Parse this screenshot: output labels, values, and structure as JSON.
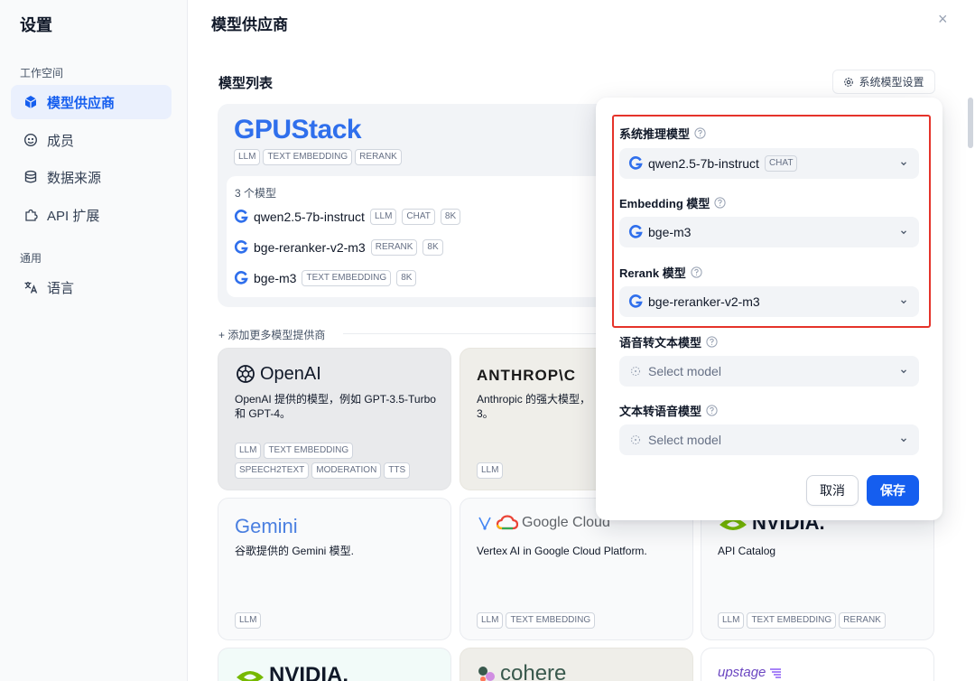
{
  "sidebar": {
    "title": "设置",
    "group_workspace": "工作空间",
    "group_general": "通用",
    "items": [
      {
        "label": "模型供应商"
      },
      {
        "label": "成员"
      },
      {
        "label": "数据来源"
      },
      {
        "label": "API 扩展"
      },
      {
        "label": "语言"
      }
    ]
  },
  "header": {
    "title": "模型供应商",
    "close": "×"
  },
  "model_list": {
    "title": "模型列表",
    "system_settings_button": "系统模型设置"
  },
  "gpustack": {
    "logo": "GPUStack",
    "tags": [
      "LLM",
      "TEXT EMBEDDING",
      "RERANK"
    ],
    "count": "3 个模型",
    "models": [
      {
        "name": "qwen2.5-7b-instruct",
        "tags": [
          "LLM",
          "CHAT",
          "8K"
        ]
      },
      {
        "name": "bge-reranker-v2-m3",
        "tags": [
          "RERANK",
          "8K"
        ]
      },
      {
        "name": "bge-m3",
        "tags": [
          "TEXT EMBEDDING",
          "8K"
        ]
      }
    ]
  },
  "add_more": "+ 添加更多模型提供商",
  "providers": [
    {
      "logo": "OpenAI",
      "desc": "OpenAI 提供的模型，例如 GPT-3.5-Turbo 和 GPT-4。",
      "tags_row1": [
        "LLM",
        "TEXT EMBEDDING"
      ],
      "tags_row2": [
        "SPEECH2TEXT",
        "MODERATION",
        "TTS"
      ]
    },
    {
      "logo": "ANTHROP\\C",
      "desc": "Anthropic 的强大模型，",
      "desc2": "3。",
      "tags_row1": [
        "LLM"
      ]
    },
    {
      "logo": "Gemini",
      "desc": "谷歌提供的 Gemini 模型.",
      "tags_row1": [
        "LLM"
      ]
    },
    {
      "logo": "Google Cloud",
      "desc": "Vertex AI in Google Cloud Platform.",
      "tags_row1": [
        "LLM",
        "TEXT EMBEDDING"
      ]
    },
    {
      "logo": "NVIDIA.",
      "desc": "API Catalog",
      "tags_row1": [
        "LLM",
        "TEXT EMBEDDING",
        "RERANK"
      ]
    },
    {
      "logo": "NVIDIA."
    },
    {
      "logo": "cohere"
    },
    {
      "logo": "upstage"
    }
  ],
  "panel": {
    "fields": [
      {
        "label": "系统推理模型",
        "value": "qwen2.5-7b-instruct",
        "badge": "CHAT"
      },
      {
        "label": "Embedding 模型",
        "value": "bge-m3"
      },
      {
        "label": "Rerank 模型",
        "value": "bge-reranker-v2-m3"
      },
      {
        "label": "语音转文本模型",
        "placeholder": "Select model"
      },
      {
        "label": "文本转语音模型",
        "placeholder": "Select model"
      }
    ],
    "cancel": "取消",
    "save": "保存"
  },
  "colors": {
    "accent": "#155eef",
    "highlight": "#e5332a",
    "gpustack": "#2f6fec"
  }
}
